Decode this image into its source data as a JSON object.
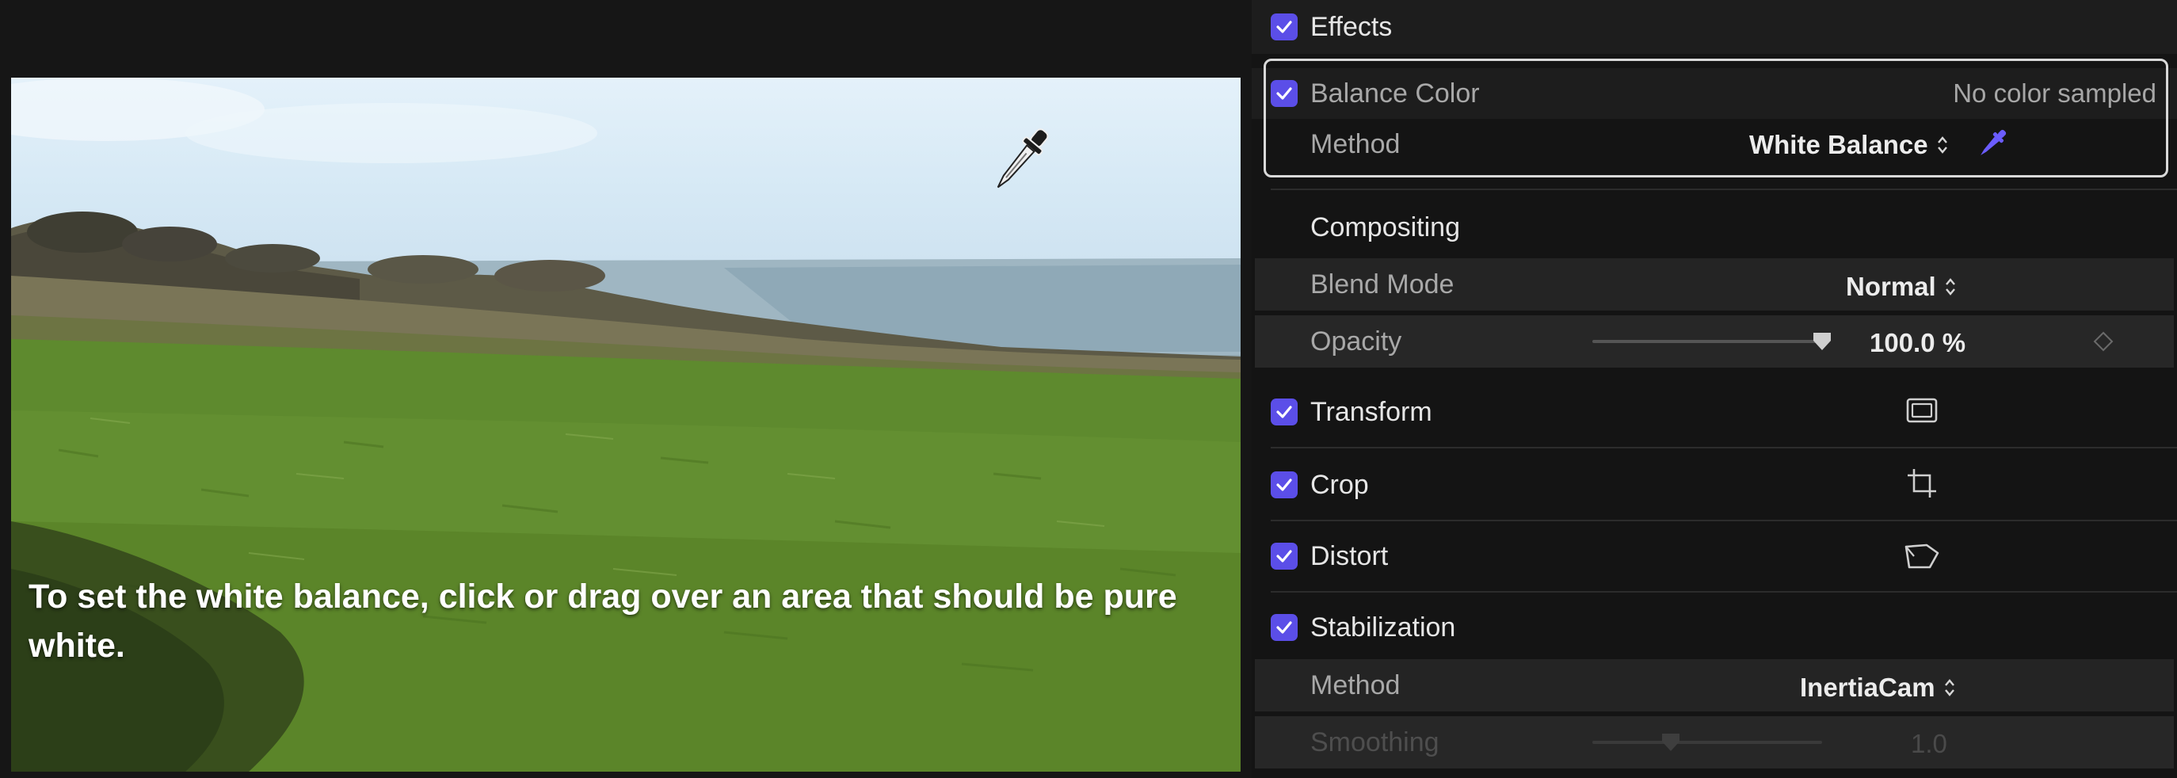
{
  "viewer": {
    "instruction": "To set the white balance, click or drag over an area that should be pure white.",
    "cursor_icon": "eyedropper-icon"
  },
  "inspector": {
    "effects": {
      "label": "Effects",
      "checked": true
    },
    "balance_color": {
      "label": "Balance Color",
      "checked": true,
      "status": "No color sampled",
      "method_label": "Method",
      "method_value": "White Balance",
      "picker_icon": "eyedropper-icon"
    },
    "compositing": {
      "label": "Compositing",
      "blend_mode_label": "Blend Mode",
      "blend_mode_value": "Normal",
      "opacity_label": "Opacity",
      "opacity_value": "100.0 %",
      "opacity_level": 1.0,
      "keyframe_icon": "diamond-keyframe-icon"
    },
    "transform": {
      "label": "Transform",
      "checked": true,
      "icon": "transform-icon"
    },
    "crop": {
      "label": "Crop",
      "checked": true,
      "icon": "crop-icon"
    },
    "distort": {
      "label": "Distort",
      "checked": true,
      "icon": "distort-icon"
    },
    "stabilization": {
      "label": "Stabilization",
      "checked": true,
      "method_label": "Method",
      "method_value": "InertiaCam",
      "smoothing_label": "Smoothing",
      "smoothing_value": "1.0"
    },
    "accent_color": "#5b4ee8"
  }
}
